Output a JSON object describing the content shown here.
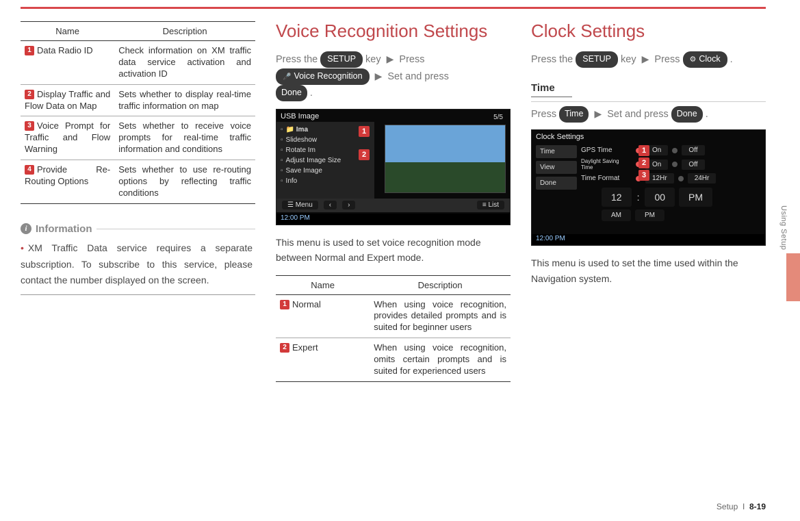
{
  "table1": {
    "header_name": "Name",
    "header_desc": "Description",
    "rows": [
      {
        "num": "1",
        "name": "Data Radio ID",
        "desc": "Check information on XM traffic data service activation and activation ID"
      },
      {
        "num": "2",
        "name": "Display Traffic and Flow Data on Map",
        "desc": "Sets whether to display real-time traffic information on map"
      },
      {
        "num": "3",
        "name": "Voice Prompt for Traffic and Flow Warning",
        "desc": "Sets whether to receive voice prompts for real-time traffic information and conditions"
      },
      {
        "num": "4",
        "name": "Provide Re-Routing Options",
        "desc": "Sets whether to use re-routing options by reflecting traffic conditions"
      }
    ]
  },
  "info": {
    "heading": "Information",
    "body": "XM Traffic Data service requires a separate subscription. To subscribe to this service, please contact the number displayed on the screen."
  },
  "voice": {
    "title": "Voice Recognition Settings",
    "instr_pre": "Press the ",
    "setup_btn": "SETUP",
    "instr_mid1": " key ",
    "instr_mid2": " Press ",
    "vr_btn": "Voice Recognition",
    "instr_mid3": " Set and press ",
    "done_btn": "Done",
    "instr_end": " .",
    "screenshot": {
      "title": "USB Image",
      "folder": "Ima",
      "rows": [
        "Slideshow",
        "Rotate Im",
        "Adjust Image Size",
        "Save Image",
        "Info"
      ],
      "counter": "5/5",
      "menu": "Menu",
      "list": "List",
      "prev": "‹",
      "next": "›",
      "clock": "12:00 PM",
      "marker1": "1",
      "marker2": "2"
    },
    "desc": "This menu is used to set voice recognition mode between Normal and Expert mode.",
    "table": {
      "header_name": "Name",
      "header_desc": "Description",
      "rows": [
        {
          "num": "1",
          "name": "Normal",
          "desc": "When using voice recognition, provides detailed prompts and is suited for beginner users"
        },
        {
          "num": "2",
          "name": "Expert",
          "desc": "When using voice recognition, omits certain prompts and is suited for experienced users"
        }
      ]
    }
  },
  "clock": {
    "title": "Clock Settings",
    "instr_pre": "Press the ",
    "setup_btn": "SETUP",
    "instr_mid": " key ",
    "instr_press": "Press ",
    "clock_btn": "Clock",
    "instr_end": " .",
    "sub_time": "Time",
    "time_instr_pre": "Press ",
    "time_btn": "Time",
    "time_instr_mid": " Set and press ",
    "done_btn": "Done",
    "time_instr_end": " .",
    "screenshot": {
      "title": "Clock Settings",
      "tabs": [
        "Time",
        "View",
        "Done"
      ],
      "rows": [
        {
          "label": "GPS Time",
          "opt1": "On",
          "opt2": "Off"
        },
        {
          "label": "Daylight Saving Time",
          "opt1": "On",
          "opt2": "Off"
        },
        {
          "label": "Time Format",
          "opt1": "12Hr",
          "opt2": "24Hr"
        }
      ],
      "hh": "12",
      "mm": "00",
      "ap": "PM",
      "am": "AM",
      "pm": "PM",
      "clock": "12:00 PM",
      "marker1": "1",
      "marker2": "2",
      "marker3": "3"
    },
    "desc": "This menu is used to set the time used within the Navigation system."
  },
  "side": {
    "label": "Using Setup"
  },
  "footer": {
    "section": "Setup",
    "sep": "I",
    "page": "8-19"
  }
}
